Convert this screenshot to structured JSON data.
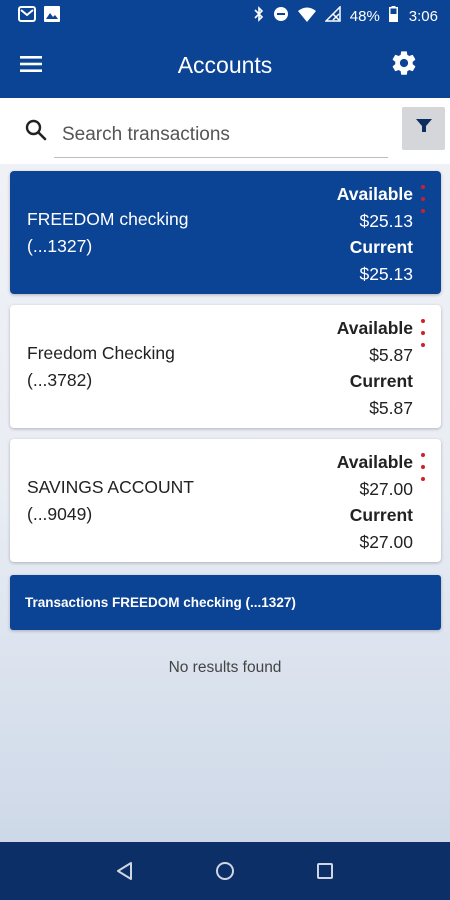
{
  "status_bar": {
    "battery": "48%",
    "time": "3:06",
    "icons_left": [
      "mail-icon",
      "image-icon"
    ],
    "icons_right": [
      "bluetooth-icon",
      "do-not-disturb-icon",
      "wifi-icon",
      "signal-off-icon",
      "battery-icon"
    ]
  },
  "app_bar": {
    "title": "Accounts",
    "menu_icon": "hamburger-icon",
    "settings_icon": "gear-icon"
  },
  "search": {
    "placeholder": "Search transactions",
    "value": ""
  },
  "accounts": [
    {
      "name": "FREEDOM checking",
      "number": "(...1327)",
      "available_label": "Available",
      "available": "$25.13",
      "current_label": "Current",
      "current": "$25.13",
      "selected": true
    },
    {
      "name": "Freedom Checking",
      "number": "(...3782)",
      "available_label": "Available",
      "available": "$5.87",
      "current_label": "Current",
      "current": "$5.87",
      "selected": false
    },
    {
      "name": "SAVINGS ACCOUNT",
      "number": "(...9049)",
      "available_label": "Available",
      "available": "$27.00",
      "current_label": "Current",
      "current": "$27.00",
      "selected": false
    }
  ],
  "transactions": {
    "header": "Transactions FREEDOM checking (...1327)",
    "empty_message": "No results found"
  },
  "colors": {
    "brand_blue": "#0b4395",
    "kebab_red": "#d21e2b",
    "nav_bar": "#0b2f66"
  }
}
